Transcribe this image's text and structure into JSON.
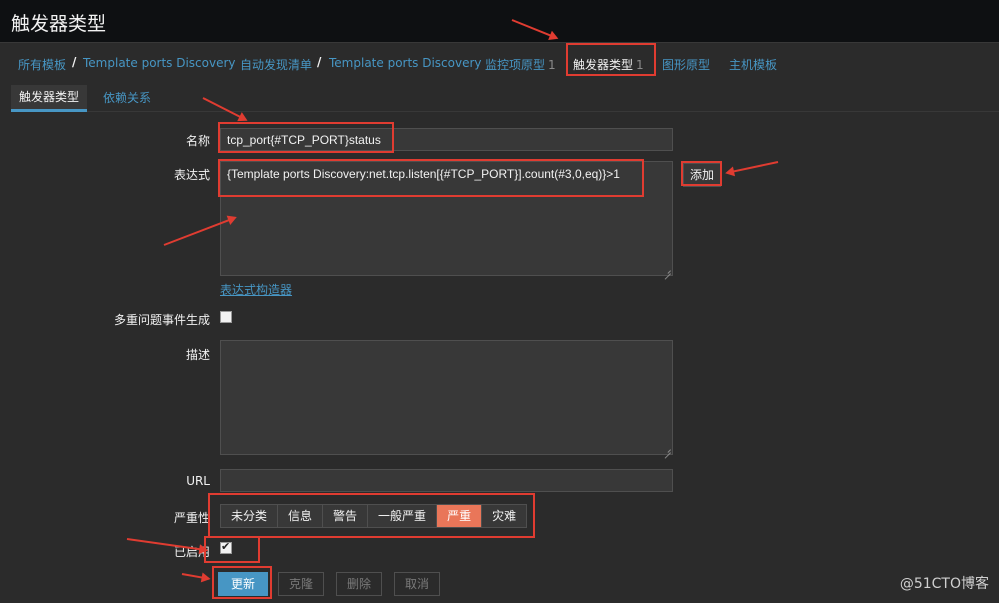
{
  "page": {
    "title": "触发器类型"
  },
  "breadcrumb": {
    "items": [
      {
        "label": "所有模板"
      },
      {
        "label": "Template ports Discovery"
      },
      {
        "label": "自动发现清单"
      },
      {
        "label": "Template ports Discovery"
      },
      {
        "label": "监控项原型",
        "count": "1"
      },
      {
        "label": "触发器类型",
        "count": "1"
      },
      {
        "label": "图形原型"
      },
      {
        "label": "主机模板"
      }
    ],
    "separator": "/"
  },
  "tabs": [
    {
      "label": "触发器类型",
      "active": true
    },
    {
      "label": "依赖关系",
      "active": false
    }
  ],
  "form": {
    "name": {
      "label": "名称",
      "value": "tcp_port{#TCP_PORT}status"
    },
    "expression": {
      "label": "表达式",
      "value": "{Template ports Discovery:net.tcp.listen[{#TCP_PORT}].count(#3,0,eq)}>1",
      "add_label": "添加",
      "constructor_label": "表达式构造器"
    },
    "multiple_events": {
      "label": "多重问题事件生成",
      "checked": false
    },
    "description": {
      "label": "描述",
      "value": ""
    },
    "url": {
      "label": "URL",
      "value": ""
    },
    "severity": {
      "label": "严重性",
      "options": [
        "未分类",
        "信息",
        "警告",
        "一般严重",
        "严重",
        "灾难"
      ],
      "selected": "严重",
      "selected_color": "#e97659"
    },
    "enabled": {
      "label": "已启用",
      "checked": true
    },
    "buttons": {
      "update": "更新",
      "clone": "克隆",
      "delete": "删除",
      "cancel": "取消"
    }
  },
  "watermark": "@51CTO博客",
  "colors": {
    "link": "#4796c4",
    "annotation": "#e03c31",
    "background": "#2b2b2b"
  }
}
